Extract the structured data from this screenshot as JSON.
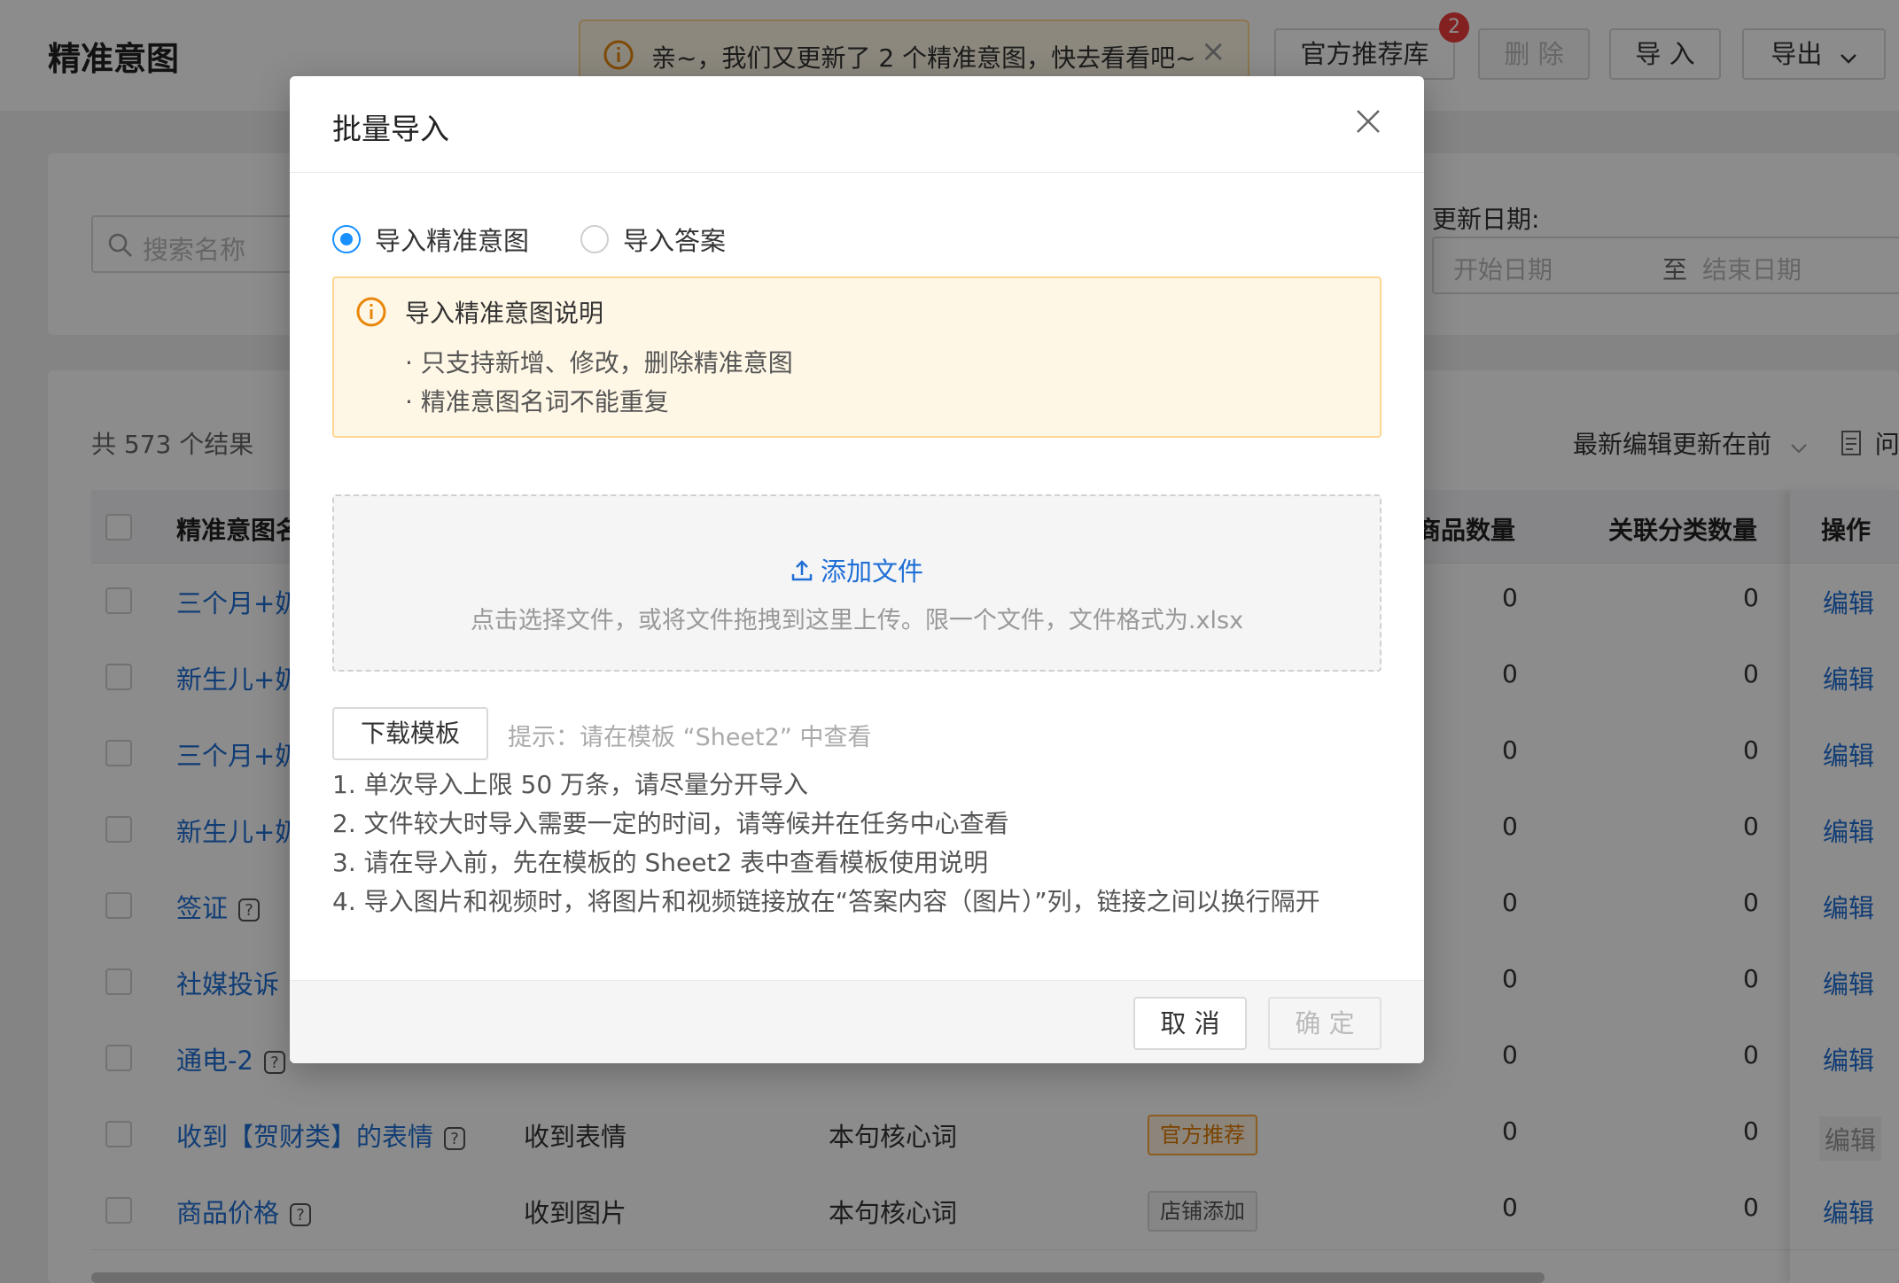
{
  "header": {
    "title": "精准意图",
    "notice": "亲~，我们又更新了 2 个精准意图，快去看看吧~",
    "buttons": {
      "recommend": "官方推荐库",
      "delete": "删 除",
      "import": "导 入",
      "export": "导出"
    },
    "badge": "2"
  },
  "filters": {
    "search_placeholder": "搜索名称",
    "update_date_label": "更新日期:",
    "start_placeholder": "开始日期",
    "to": "至",
    "end_placeholder": "结束日期"
  },
  "list": {
    "count": "共 573 个结果",
    "sort": "最新编辑更新在前",
    "right_cut": "问",
    "columns": {
      "name": "精准意图名",
      "goods": "商品数量",
      "category": "关联分类数量",
      "op": "操作"
    },
    "rows": [
      {
        "name": "三个月+奶",
        "goods": "0",
        "cat": "0",
        "op": "编辑"
      },
      {
        "name": "新生儿+奶",
        "goods": "0",
        "cat": "0",
        "op": "编辑"
      },
      {
        "name": "三个月+奶",
        "goods": "0",
        "cat": "0",
        "op": "编辑"
      },
      {
        "name": "新生儿+奶",
        "goods": "0",
        "cat": "0",
        "op": "编辑"
      },
      {
        "name": "签证",
        "goods": "0",
        "cat": "0",
        "op": "编辑"
      },
      {
        "name": "社媒投诉",
        "goods": "0",
        "cat": "0",
        "op": "编辑"
      },
      {
        "name": "通电-2",
        "goods": "0",
        "cat": "0",
        "op": "编辑"
      },
      {
        "name": "收到【贺财类】的表情",
        "type": "收到表情",
        "match": "本句核心词",
        "tag": "官方推荐",
        "goods": "0",
        "cat": "0",
        "op": "编辑"
      },
      {
        "name": "商品价格",
        "type": "收到图片",
        "match": "本句核心词",
        "tag": "店铺添加",
        "goods": "0",
        "cat": "0",
        "op": "编辑"
      }
    ]
  },
  "modal": {
    "title": "批量导入",
    "radio_intent": "导入精准意图",
    "radio_answer": "导入答案",
    "info_title": "导入精准意图说明",
    "info_line1": "· 只支持新增、修改，删除精准意图",
    "info_line2": "· 精准意图名词不能重复",
    "add_file": "添加文件",
    "drop_hint": "点击选择文件，或将文件拖拽到这里上传。限一个文件，文件格式为.xlsx",
    "download_template": "下载模板",
    "tip": "提示：请在模板 “Sheet2” 中查看",
    "note1": "1. 单次导入上限 50 万条，请尽量分开导入",
    "note2": "2. 文件较大时导入需要一定的时间，请等候并在任务中心查看",
    "note3": "3. 请在导入前，先在模板的 Sheet2 表中查看模板使用说明",
    "note4": "4. 导入图片和视频时，将图片和视频链接放在“答案内容（图片）”列，链接之间以换行隔开",
    "cancel": "取 消",
    "confirm": "确 定"
  },
  "colors": {
    "accent": "#1890ff",
    "link": "#1f6fd6",
    "warning_bg": "#fff7e6",
    "warning_border": "#ffd591",
    "badge": "#ee3b3b"
  }
}
